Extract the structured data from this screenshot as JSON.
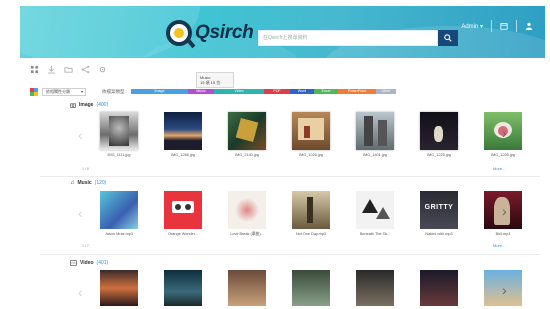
{
  "header": {
    "logo_text": "Qsirch",
    "search_placeholder": "在Qsirch上搜尋資料",
    "user_label": "Admin ▾"
  },
  "tooltip": {
    "line1": "Music",
    "line2": "15 項 15 位"
  },
  "filter": {
    "dropdown_value": "依相關性分類",
    "type_label": "依檔案類型 :",
    "pills": [
      {
        "label": "Image",
        "color": "#4aa0e0",
        "width": 57
      },
      {
        "label": "Music",
        "color": "#b54fd1",
        "width": 26
      },
      {
        "label": "Video",
        "color": "#2fb4b0",
        "width": 50
      },
      {
        "label": "PDF",
        "color": "#e23b4a",
        "width": 26
      },
      {
        "label": "Word",
        "color": "#2f63c9",
        "width": 24
      },
      {
        "label": "Excel",
        "color": "#4fb85a",
        "width": 24
      },
      {
        "label": "PowerPoint",
        "color": "#f07c3a",
        "width": 38
      },
      {
        "label": "Other",
        "color": "#a9b6c8",
        "width": 20
      }
    ]
  },
  "sections": {
    "image": {
      "title": "Image",
      "count": "(400)",
      "more": "More...",
      "note": "1 / 8"
    },
    "music": {
      "title": "Music",
      "count": "(120)",
      "more": "More...",
      "note": "1 / 7"
    },
    "video": {
      "title": "Video",
      "count": "(401)"
    }
  },
  "image_items": [
    "IMG_1111.jpg",
    "IMG_1266.jpg",
    "IMG_2140.jpg",
    "IMG_1026.jpg",
    "IMG_1401.jpg",
    "IMG_1225.jpg",
    "IMG_1205.jpg"
  ],
  "music_items": [
    "Jason Mraz.mp3",
    "Orange Wonder...",
    "Love Break (單曲)...",
    "Not One Day.mp3",
    "Beneath The Sk...",
    "Naked with.mp3",
    "Bull.mp3"
  ],
  "music_cover_texts": {
    "gritty": "GRITTY"
  }
}
